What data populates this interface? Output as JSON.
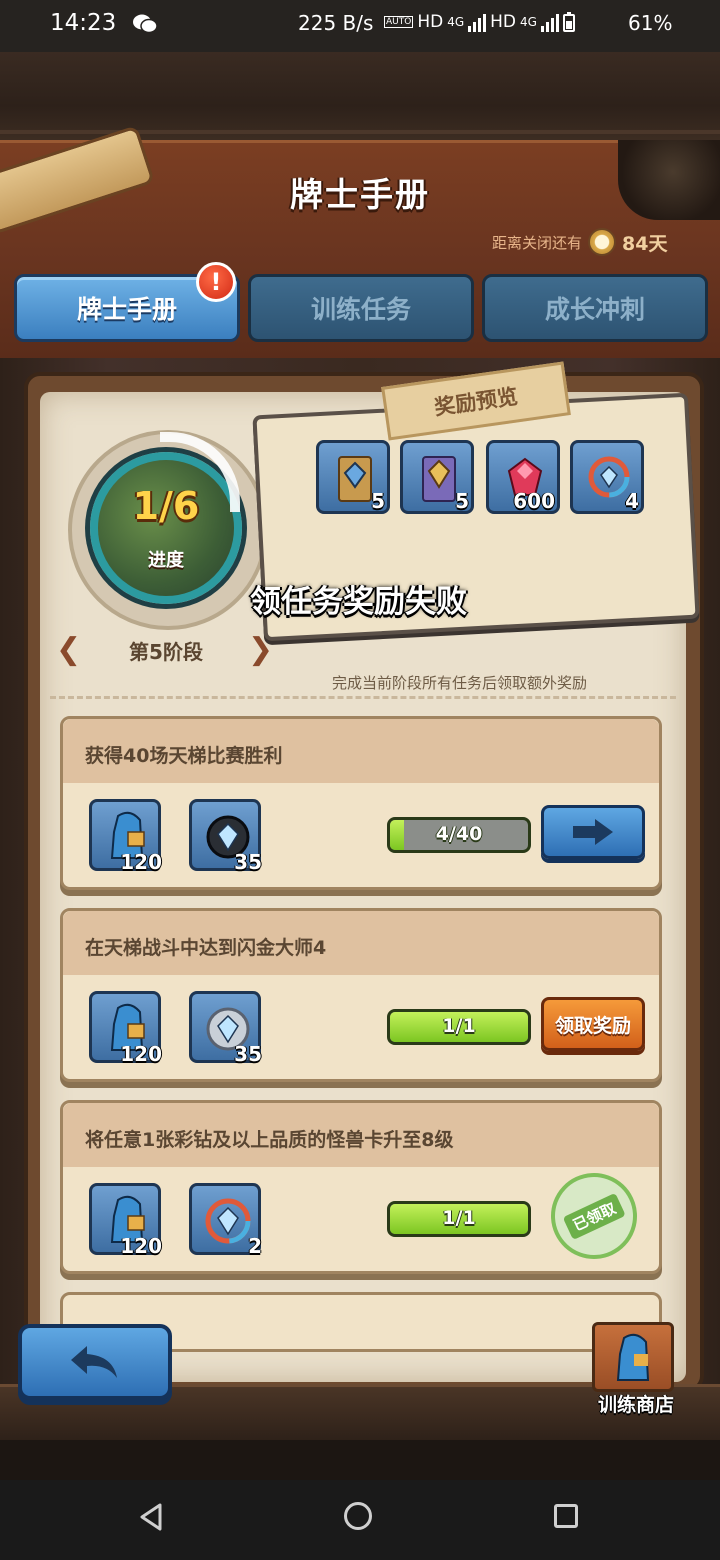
{
  "status_bar": {
    "time": "14:23",
    "net_speed": "225 B/s",
    "sim_icons": [
      "AUTO",
      "HD",
      "4G",
      "HD",
      "4G"
    ],
    "battery": "61%"
  },
  "page": {
    "title": "牌士手册"
  },
  "countdown": {
    "label": "距离关闭还有",
    "value": "84天"
  },
  "tabs": [
    {
      "label": "牌士手册",
      "active": true,
      "badge": "!"
    },
    {
      "label": "训练任务",
      "active": false
    },
    {
      "label": "成长冲刺",
      "active": false
    }
  ],
  "progress": {
    "current": 1,
    "total": 6,
    "text": "1/6",
    "label": "进度"
  },
  "stage": {
    "label": "第5阶段"
  },
  "reward_preview": {
    "tag": "奖励预览",
    "items": [
      {
        "icon": "gold-card-pack-icon",
        "count": "5"
      },
      {
        "icon": "purple-card-pack-icon",
        "count": "5"
      },
      {
        "icon": "red-gem-icon",
        "count": "600"
      },
      {
        "icon": "rainbow-diamond-icon",
        "count": "4"
      }
    ]
  },
  "toast": "领任务奖励失败",
  "hint": "完成当前阶段所有任务后领取额外奖励",
  "tasks": [
    {
      "name": "获得40场天梯比赛胜利",
      "rewards": [
        {
          "icon": "trainer-exp-icon",
          "count": "120"
        },
        {
          "icon": "black-diamond-icon",
          "count": "35"
        }
      ],
      "progress_text": "4/40",
      "progress_value": 0.1,
      "action": "go"
    },
    {
      "name": "在天梯战斗中达到闪金大师4",
      "rewards": [
        {
          "icon": "trainer-exp-icon",
          "count": "120"
        },
        {
          "icon": "silver-diamond-icon",
          "count": "35"
        }
      ],
      "progress_text": "1/1",
      "progress_value": 1,
      "action": "claim",
      "action_label": "领取奖励"
    },
    {
      "name": "将任意1张彩钻及以上品质的怪兽卡升至8级",
      "rewards": [
        {
          "icon": "trainer-exp-icon",
          "count": "120"
        },
        {
          "icon": "rainbow-diamond-icon",
          "count": "2"
        }
      ],
      "progress_text": "1/1",
      "progress_value": 1,
      "action": "claimed",
      "action_label": "已领取"
    }
  ],
  "shop": {
    "label": "训练商店"
  },
  "colors": {
    "accent_blue": "#3b7fbf",
    "progress_green": "#7cc622",
    "claim_orange": "#d2601a",
    "gold_text": "#ffd34a"
  }
}
